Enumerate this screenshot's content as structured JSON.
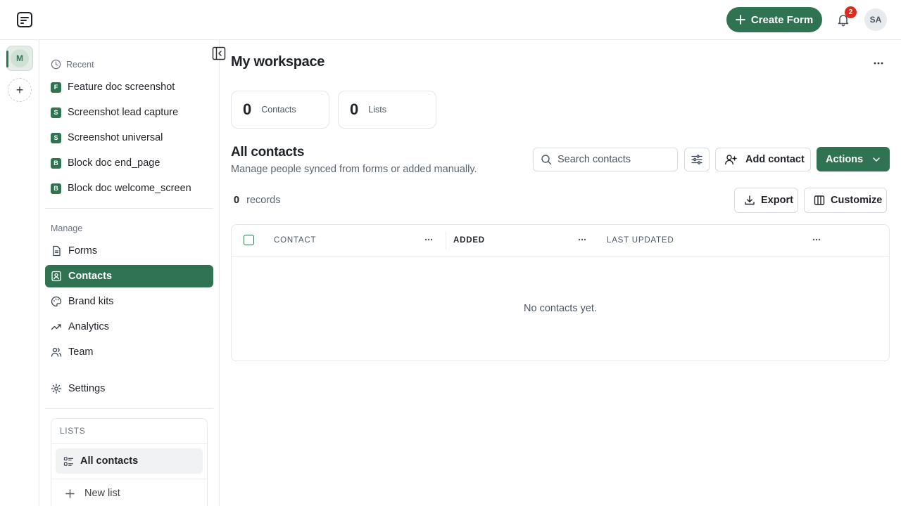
{
  "topbar": {
    "create_form_label": "Create Form",
    "notification_count": "2",
    "user_initials": "SA"
  },
  "workspaces": {
    "current_initial": "M",
    "add_symbol": "+"
  },
  "sidebar": {
    "recent_label": "Recent",
    "recent": [
      {
        "badge": "F",
        "label": "Feature doc screenshot"
      },
      {
        "badge": "S",
        "label": "Screenshot lead capture"
      },
      {
        "badge": "S",
        "label": "Screenshot universal"
      },
      {
        "badge": "B",
        "label": "Block doc end_page"
      },
      {
        "badge": "B",
        "label": "Block doc welcome_screen"
      }
    ],
    "manage_label": "Manage",
    "nav": [
      {
        "label": "Forms",
        "icon": "document-icon"
      },
      {
        "label": "Contacts",
        "icon": "contact-card-icon",
        "active": true
      },
      {
        "label": "Brand kits",
        "icon": "palette-icon"
      },
      {
        "label": "Analytics",
        "icon": "trend-icon"
      },
      {
        "label": "Team",
        "icon": "people-icon"
      }
    ],
    "settings_label": "Settings",
    "lists": {
      "title": "LISTS",
      "items": [
        {
          "label": "All contacts"
        }
      ],
      "new_list_label": "New list"
    }
  },
  "main": {
    "title": "My workspace",
    "stats": [
      {
        "value": "0",
        "label": "Contacts"
      },
      {
        "value": "0",
        "label": "Lists"
      }
    ],
    "section_title": "All contacts",
    "section_subtitle": "Manage people synced from forms or added manually.",
    "search_placeholder": "Search contacts",
    "add_contact_label": "Add contact",
    "actions_label": "Actions",
    "records_count": "0",
    "records_label": "records",
    "export_label": "Export",
    "customize_label": "Customize",
    "table": {
      "columns": [
        "CONTACT",
        "ADDED",
        "LAST UPDATED"
      ],
      "empty_message": "No contacts yet."
    }
  },
  "colors": {
    "accent": "#2f7352",
    "badge": "#d92d20"
  }
}
